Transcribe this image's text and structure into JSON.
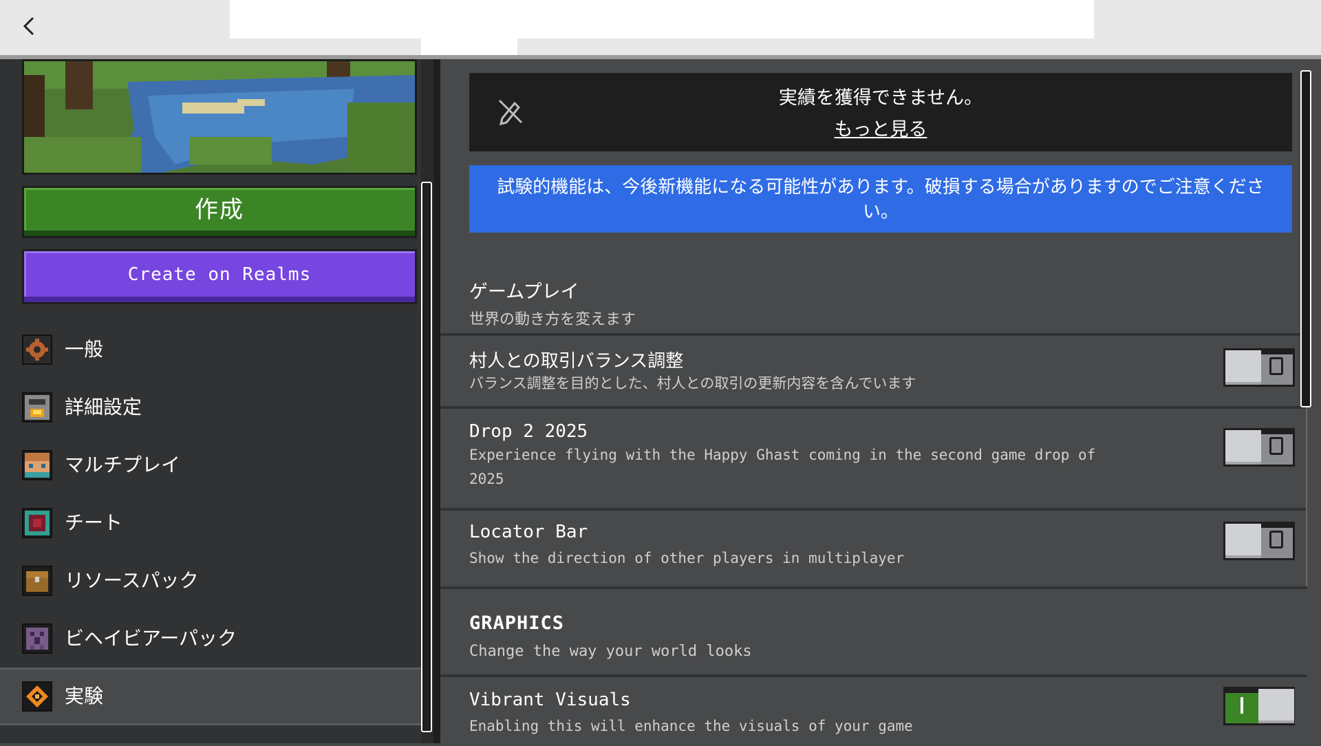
{
  "topbar": {
    "back_icon": "chevron-left-icon"
  },
  "sidebar": {
    "create_label": "作成",
    "realms_label": "Create on Realms",
    "items": [
      {
        "label": "一般",
        "icon": "gear-icon"
      },
      {
        "label": "詳細設定",
        "icon": "furnace-icon"
      },
      {
        "label": "マルチプレイ",
        "icon": "player-head-icon"
      },
      {
        "label": "チート",
        "icon": "command-block-icon"
      },
      {
        "label": "リソースパック",
        "icon": "chest-icon"
      },
      {
        "label": "ビヘイビアーパック",
        "icon": "creeper-icon"
      },
      {
        "label": "実験",
        "icon": "experiments-icon",
        "active": true
      }
    ]
  },
  "main": {
    "achievement_text": "実績を獲得できません。",
    "achievement_link": "もっと見る",
    "notice": "試験的機能は、今後新機能になる可能性があります。破損する場合がありますのでご注意ください。",
    "gameplay_header": "ゲームプレイ",
    "gameplay_sub": "世界の動き方を変えます",
    "rows": [
      {
        "title": "村人との取引バランス調整",
        "desc": "バランス調整を目的とした、村人との取引の更新内容を含んでいます",
        "enabled": false
      },
      {
        "title": "Drop 2 2025",
        "desc": "Experience flying with the Happy Ghast coming in the second game drop of 2025",
        "enabled": false
      },
      {
        "title": "Locator Bar",
        "desc": "Show the direction of other players in multiplayer",
        "enabled": false
      }
    ],
    "graphics_header": "GRAPHICS",
    "graphics_sub": "Change the way your world looks",
    "vibrant": {
      "title": "Vibrant Visuals",
      "desc": "Enabling this will enhance the visuals of your game",
      "enabled": true
    }
  },
  "colors": {
    "create_green": "#3c8527",
    "realms_purple": "#7745e0",
    "notice_blue": "#2e6be5",
    "toggle_on": "#3c8527"
  }
}
